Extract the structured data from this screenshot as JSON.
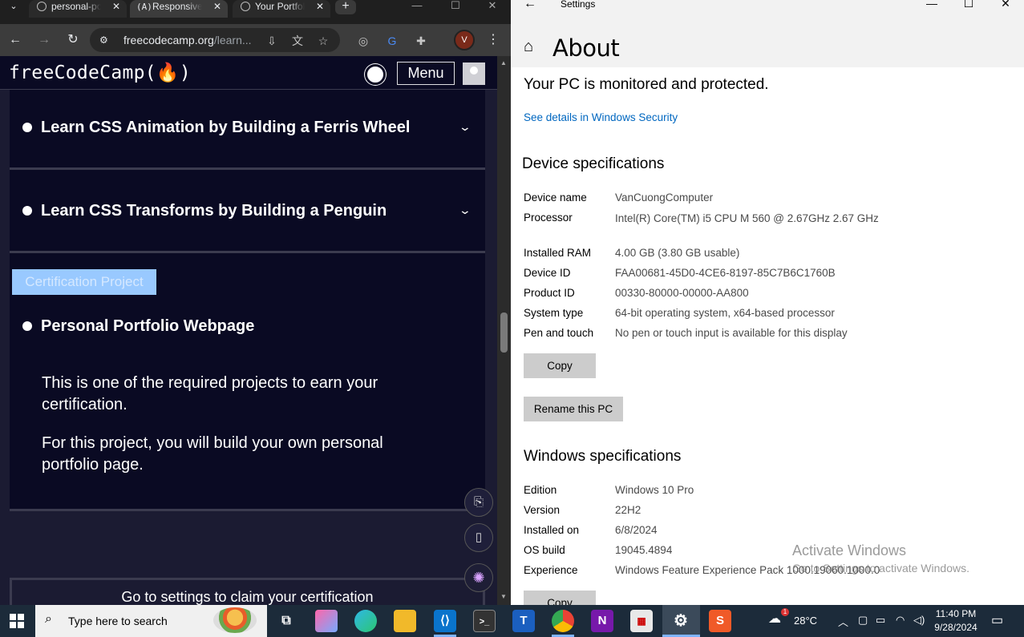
{
  "browser": {
    "tabs": [
      {
        "title": "personal-portfolio",
        "active": false
      },
      {
        "title": "Responsive Web Design",
        "active": true
      },
      {
        "title": "Your Portfolio",
        "active": false
      }
    ],
    "url_host": "freecodecamp.org",
    "url_path": "/learn..."
  },
  "fcc": {
    "logo": "freeCodeCamp(🔥)",
    "menu_label": "Menu",
    "blocks": [
      {
        "title": "Learn CSS Animation by Building a Ferris Wheel"
      },
      {
        "title": "Learn CSS Transforms by Building a Penguin"
      }
    ],
    "cert_tag": "Certification Project",
    "project_title": "Personal Portfolio Webpage",
    "desc1": "This is one of the required projects to earn your certification.",
    "desc2": "For this project, you will build your own personal portfolio page.",
    "claim_button": "Go to settings to claim your certification"
  },
  "settings": {
    "app_title": "Settings",
    "page_title": "About",
    "protection_status": "Your PC is monitored and protected.",
    "security_link": "See details in Windows Security",
    "device_heading": "Device specifications",
    "device_specs": [
      {
        "label": "Device name",
        "value": "VanCuongComputer"
      },
      {
        "label": "Processor",
        "value": "Intel(R) Core(TM) i5 CPU       M 560  @ 2.67GHz   2.67 GHz"
      },
      {
        "label": "Installed RAM",
        "value": "4.00 GB (3.80 GB usable)"
      },
      {
        "label": "Device ID",
        "value": "FAA00681-45D0-4CE6-8197-85C7B6C1760B"
      },
      {
        "label": "Product ID",
        "value": "00330-80000-00000-AA800"
      },
      {
        "label": "System type",
        "value": "64-bit operating system, x64-based processor"
      },
      {
        "label": "Pen and touch",
        "value": "No pen or touch input is available for this display"
      }
    ],
    "copy_label": "Copy",
    "rename_label": "Rename this PC",
    "windows_heading": "Windows specifications",
    "windows_specs": [
      {
        "label": "Edition",
        "value": "Windows 10 Pro"
      },
      {
        "label": "Version",
        "value": "22H2"
      },
      {
        "label": "Installed on",
        "value": "6/8/2024"
      },
      {
        "label": "OS build",
        "value": "19045.4894"
      },
      {
        "label": "Experience",
        "value": "Windows Feature Experience Pack 1000.19060.1000.0"
      }
    ],
    "watermark_title": "Activate Windows",
    "watermark_sub": "Go to Settings to activate Windows."
  },
  "taskbar": {
    "search_placeholder": "Type here to search",
    "weather": "28°C",
    "time": "11:40 PM",
    "date": "9/28/2024",
    "weather_badge": "1"
  }
}
